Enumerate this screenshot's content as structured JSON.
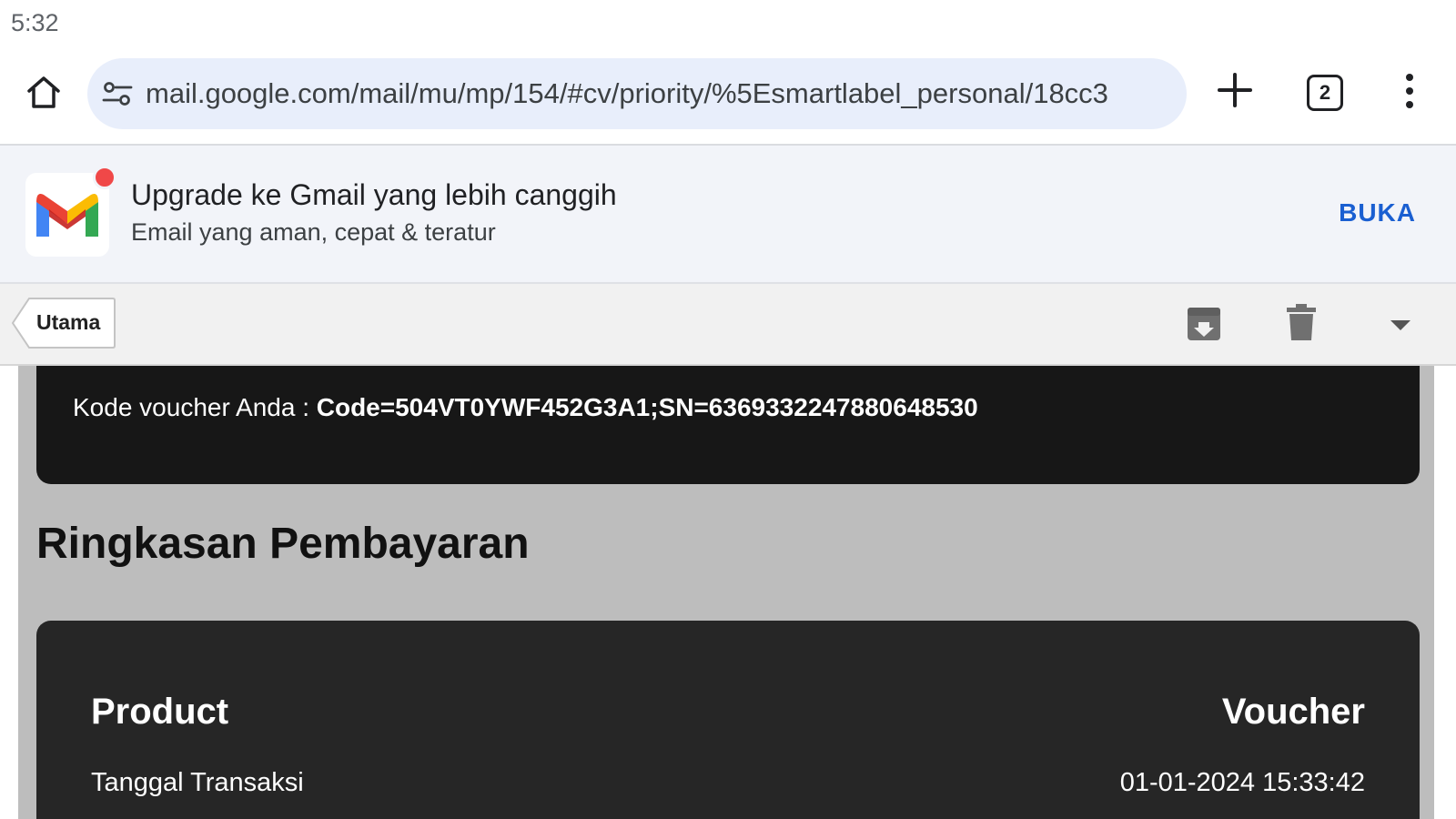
{
  "status_bar": {
    "time": "5:32"
  },
  "browser": {
    "url": "mail.google.com/mail/mu/mp/154/#cv/priority/%5Esmartlabel_personal/18cc3",
    "tab_count": "2"
  },
  "banner": {
    "title": "Upgrade ke Gmail yang lebih canggih",
    "subtitle": "Email yang aman, cepat & teratur",
    "open_label": "BUKA"
  },
  "action_bar": {
    "back_label": "Utama"
  },
  "email": {
    "voucher_prefix": "Kode voucher Anda : ",
    "voucher_code": "Code=504VT0YWF452G3A1;SN=6369332247880648530",
    "summary_heading": "Ringkasan Pembayaran",
    "summary_rows": [
      {
        "label": "Product",
        "value": "Voucher"
      },
      {
        "label": "Tanggal Transaksi",
        "value": "01-01-2024 15:33:42"
      }
    ]
  },
  "colors": {
    "url_bar_bg": "#e8eefb",
    "banner_bg": "#f2f4f9",
    "accent_link": "#1a5fd1",
    "notification_dot": "#f04848",
    "voucher_box_bg": "#171717",
    "summary_card_bg": "#262626",
    "content_bg": "#bdbdbd"
  }
}
